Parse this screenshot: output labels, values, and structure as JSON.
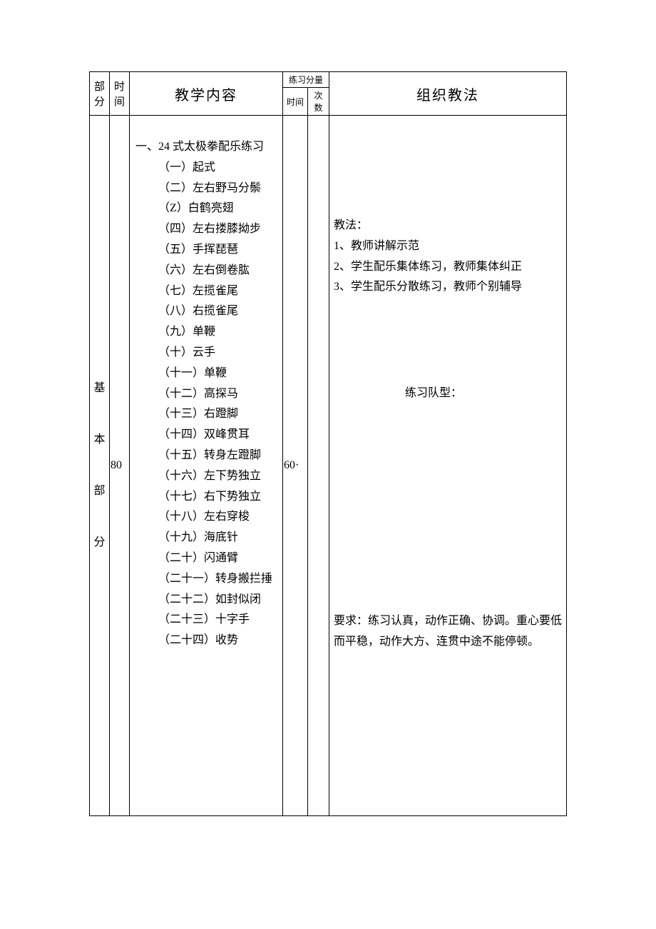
{
  "headers": {
    "part": "部分",
    "time": "时间",
    "content": "教学内容",
    "amount": "练习分量",
    "amount_time": "时间",
    "amount_count": "次数",
    "method": "组织教法"
  },
  "row": {
    "part_chars": [
      "基",
      "本",
      "部",
      "分"
    ],
    "time_value": "80",
    "amount_time_value": "60·",
    "amount_count_value": "",
    "content_title": "一、24 式太极拳配乐练习",
    "content_items": [
      "（一）起式",
      "（二）左右野马分鬃",
      "（Z）白鹤亮翅",
      "（四）左右搂膝拗步",
      "（五）手挥琵琶",
      "（六）左右倒卷肱",
      "（七）左揽雀尾",
      "（八）右揽雀尾",
      "（九）单鞭",
      "（十）云手",
      "（十一）单鞭",
      "（十二）高探马",
      "（十三）右蹬脚",
      "（十四）双峰贯耳",
      "（十五）转身左蹬脚",
      "（十六）左下势独立",
      "（十七）右下势独立",
      "（十八）左右穿梭",
      "（十九）海底针",
      "（二十）闪通臂",
      "（二十一）转身搬拦捶",
      "（二十二）如封似闭",
      "（二十三）十字手",
      "（二十四）收势"
    ],
    "method_block1_title": "教法：",
    "method_block1_items": [
      "1、教师讲解示范",
      "2、学生配乐集体练习，教师集体纠正",
      "3、学生配乐分散练习，教师个别辅导"
    ],
    "method_block2": "练习队型：",
    "method_block3": "要求：练习认真，动作正确、协调。重心要低而平稳，动作大方、连贯中途不能停顿。"
  }
}
